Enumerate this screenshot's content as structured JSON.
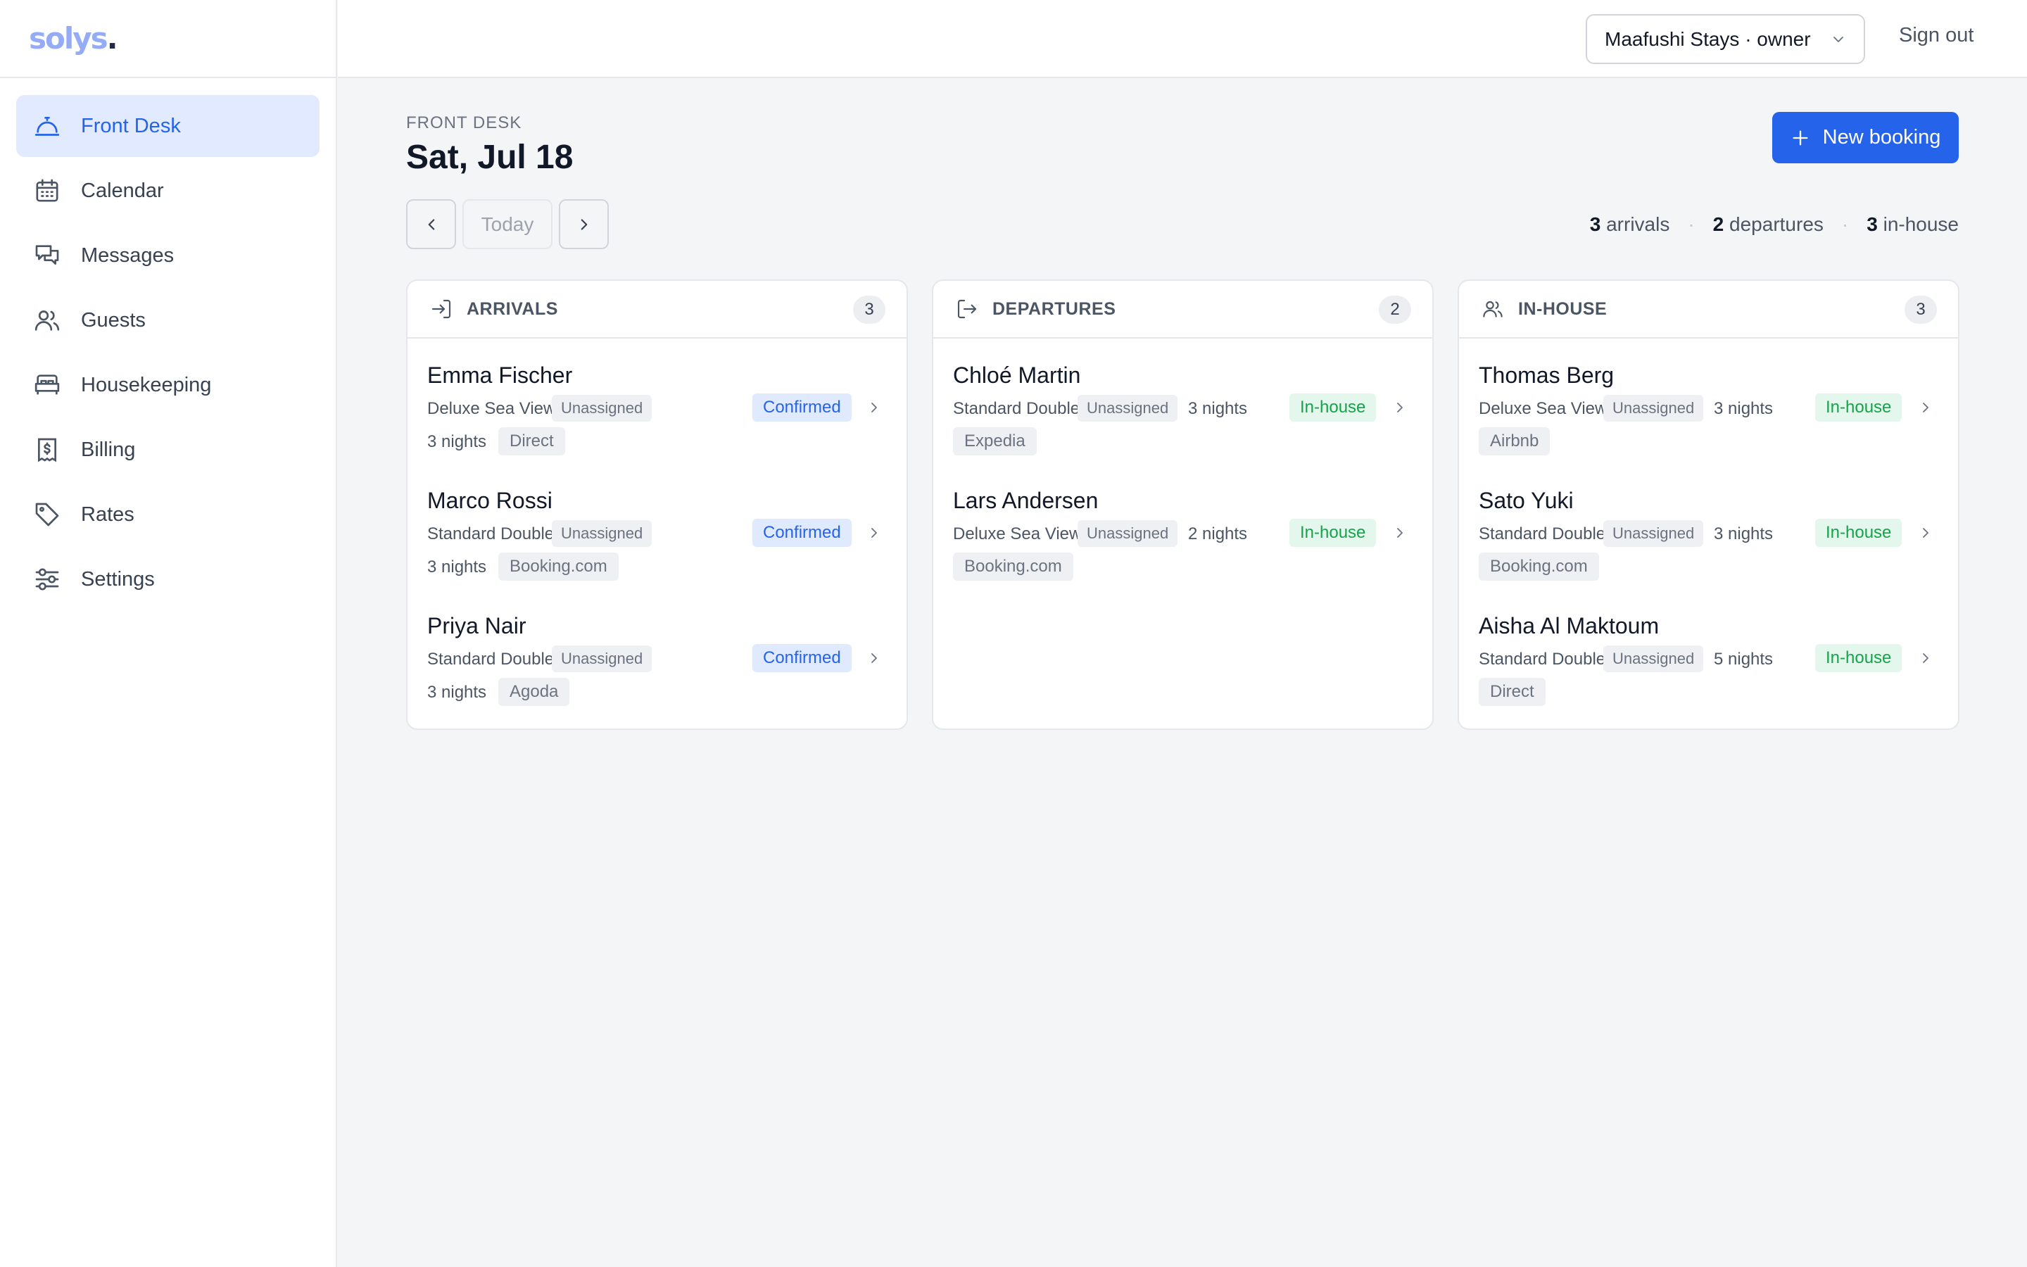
{
  "app": {
    "logo": "solys",
    "logo_dot": "."
  },
  "sidebar": {
    "items": [
      {
        "label": "Front Desk",
        "icon": "bell-icon"
      },
      {
        "label": "Calendar",
        "icon": "calendar-icon"
      },
      {
        "label": "Messages",
        "icon": "messages-icon"
      },
      {
        "label": "Guests",
        "icon": "users-icon"
      },
      {
        "label": "Housekeeping",
        "icon": "bed-icon"
      },
      {
        "label": "Billing",
        "icon": "receipt-icon"
      },
      {
        "label": "Rates",
        "icon": "tag-icon"
      },
      {
        "label": "Settings",
        "icon": "sliders-icon"
      }
    ],
    "active": "Front Desk"
  },
  "topbar": {
    "account": "Maafushi Stays · owner",
    "sign_out": "Sign out"
  },
  "header": {
    "section": "FRONT DESK",
    "date": "Sat, Jul 18",
    "today_label": "Today",
    "new_booking_label": "New booking"
  },
  "summary": {
    "arrivals_count": "3",
    "arrivals_label": "arrivals",
    "departures_count": "2",
    "departures_label": "departures",
    "inhouse_count": "3",
    "inhouse_label": "in-house",
    "separator": "·"
  },
  "columns": [
    {
      "title": "ARRIVALS",
      "count": "3",
      "icon": "arrival-icon",
      "bookings": [
        {
          "guest": "Emma Fischer",
          "room": "Deluxe Sea View",
          "assignment": "Unassigned",
          "nights": "3 nights",
          "channel": "Direct",
          "status": "Confirmed"
        },
        {
          "guest": "Marco Rossi",
          "room": "Standard Double",
          "assignment": "Unassigned",
          "nights": "3 nights",
          "channel": "Booking.com",
          "status": "Confirmed"
        },
        {
          "guest": "Priya Nair",
          "room": "Standard Double",
          "assignment": "Unassigned",
          "nights": "3 nights",
          "channel": "Agoda",
          "status": "Confirmed"
        }
      ]
    },
    {
      "title": "DEPARTURES",
      "count": "2",
      "icon": "departure-icon",
      "bookings": [
        {
          "guest": "Chloé Martin",
          "room": "Standard Double",
          "assignment": "Unassigned",
          "nights": "3 nights",
          "channel": "Expedia",
          "status": "In-house"
        },
        {
          "guest": "Lars Andersen",
          "room": "Deluxe Sea View",
          "assignment": "Unassigned",
          "nights": "2 nights",
          "channel": "Booking.com",
          "status": "In-house"
        }
      ]
    },
    {
      "title": "IN-HOUSE",
      "count": "3",
      "icon": "users-icon",
      "bookings": [
        {
          "guest": "Thomas Berg",
          "room": "Deluxe Sea View",
          "assignment": "Unassigned",
          "nights": "3 nights",
          "channel": "Airbnb",
          "status": "In-house"
        },
        {
          "guest": "Sato Yuki",
          "room": "Standard Double",
          "assignment": "Unassigned",
          "nights": "3 nights",
          "channel": "Booking.com",
          "status": "In-house"
        },
        {
          "guest": "Aisha Al Maktoum",
          "room": "Standard Double",
          "assignment": "Unassigned",
          "nights": "5 nights",
          "channel": "Direct",
          "status": "In-house"
        }
      ]
    }
  ],
  "colors": {
    "accent": "#2563eb",
    "active_nav_bg": "#e1eafe",
    "confirmed_bg": "#e0eafe",
    "inhouse_text": "#16a34a",
    "inhouse_bg": "#e3f7ec"
  }
}
